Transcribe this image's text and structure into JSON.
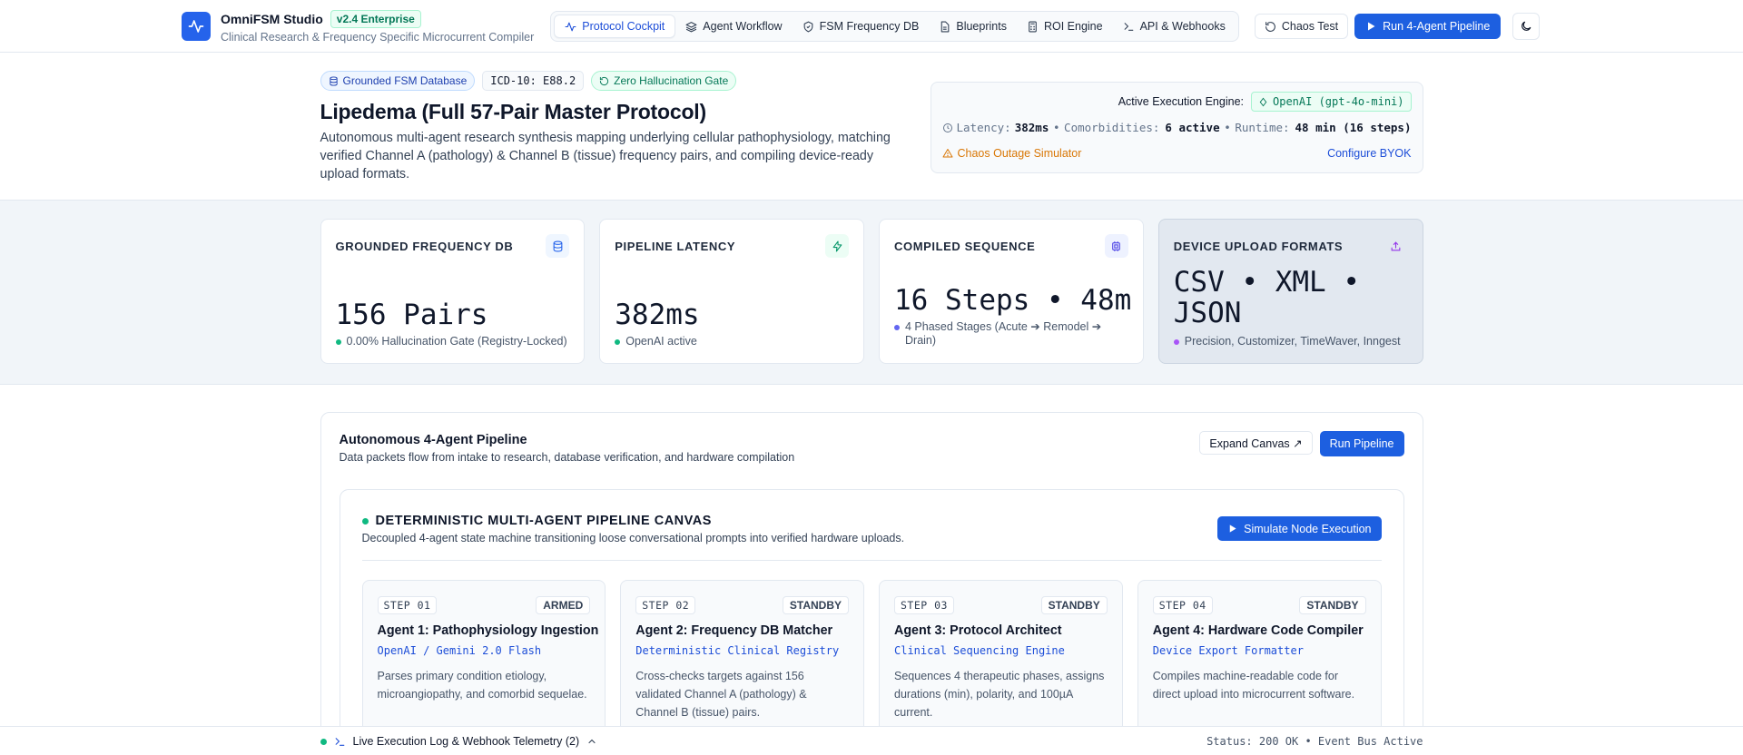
{
  "header": {
    "brand_name": "OmniFSM Studio",
    "brand_version": "v2.4 Enterprise",
    "brand_subtitle": "Clinical Research & Frequency Specific Microcurrent Compiler",
    "nav": [
      {
        "label": "Protocol Cockpit",
        "icon": "activity-icon",
        "active": true
      },
      {
        "label": "Agent Workflow",
        "icon": "layers-icon",
        "active": false
      },
      {
        "label": "FSM Frequency DB",
        "icon": "shield-icon",
        "active": false
      },
      {
        "label": "Blueprints",
        "icon": "file-icon",
        "active": false
      },
      {
        "label": "ROI Engine",
        "icon": "calculator-icon",
        "active": false
      },
      {
        "label": "API & Webhooks",
        "icon": "terminal-icon",
        "active": false
      }
    ],
    "chaos_test_label": "Chaos Test",
    "run_pipeline_label": "Run 4-Agent Pipeline",
    "theme_toggle_icon": "moon-icon"
  },
  "hero": {
    "tags": {
      "database": "Grounded FSM Database",
      "icd": "ICD-10: E88.2",
      "gate": "Zero Hallucination Gate"
    },
    "title": "Lipedema (Full 57-Pair Master Protocol)",
    "description": "Autonomous multi-agent research synthesis mapping underlying cellular pathophysiology, matching verified Channel A (pathology) & Channel B (tissue) frequency pairs, and compiling device-ready upload formats."
  },
  "engine": {
    "label": "Active Execution Engine:",
    "engine_name": "OpenAI (gpt-4o-mini)",
    "latency_label": "Latency:",
    "latency_value": "382ms",
    "comorbidities_label": "Comorbidities:",
    "comorbidities_value": "6 active",
    "runtime_label": "Runtime:",
    "runtime_value": "48 min (16 steps)",
    "separator": "•",
    "chaos_label": "Chaos Outage Simulator",
    "byok_label": "Configure BYOK"
  },
  "stats": [
    {
      "title": "GROUNDED FREQUENCY DB",
      "value": "156 Pairs",
      "foot": "0.00% Hallucination Gate (Registry-Locked)",
      "icon": "database-icon",
      "color": "#2563eb",
      "icon_bg": "#eff6ff",
      "dot": "#10b981"
    },
    {
      "title": "PIPELINE LATENCY",
      "value": "382ms",
      "foot": "OpenAI active",
      "icon": "zap-icon",
      "color": "#059669",
      "icon_bg": "#ecfdf5",
      "dot": "#10b981"
    },
    {
      "title": "COMPILED SEQUENCE",
      "value": "16 Steps • 48m",
      "foot": "4 Phased Stages (Acute ➔ Remodel ➔ Drain)",
      "icon": "cpu-icon",
      "color": "#4f46e5",
      "icon_bg": "#eef2ff",
      "dot": "#6366f1"
    },
    {
      "title": "DEVICE UPLOAD FORMATS",
      "value": "CSV • XML • JSON",
      "foot": "Precision, Customizer, TimeWaver, Inngest",
      "icon": "upload-icon",
      "color": "#9333ea",
      "icon_bg": "transparent",
      "dot": "#a855f7"
    }
  ],
  "pipeline": {
    "title": "Autonomous 4-Agent Pipeline",
    "subtitle": "Data packets flow from intake to research, database verification, and hardware compilation",
    "expand_label": "Expand Canvas ↗",
    "run_label": "Run Pipeline",
    "canvas_title": "DETERMINISTIC MULTI-AGENT PIPELINE CANVAS",
    "canvas_subtitle": "Decoupled 4-agent state machine transitioning loose conversational prompts into verified hardware uploads.",
    "simulate_label": "Simulate Node Execution",
    "agents": [
      {
        "step": "STEP 01",
        "status": "ARMED",
        "name": "Agent 1: Pathophysiology Ingestion",
        "model": "OpenAI / Gemini 2.0 Flash",
        "desc": "Parses primary condition etiology, microangiopathy, and comorbid sequelae."
      },
      {
        "step": "STEP 02",
        "status": "STANDBY",
        "name": "Agent 2: Frequency DB Matcher",
        "model": "Deterministic Clinical Registry",
        "desc": "Cross-checks targets against 156 validated Channel A (pathology) & Channel B (tissue) pairs."
      },
      {
        "step": "STEP 03",
        "status": "STANDBY",
        "name": "Agent 3: Protocol Architect",
        "model": "Clinical Sequencing Engine",
        "desc": "Sequences 4 therapeutic phases, assigns durations (min), polarity, and 100µA current."
      },
      {
        "step": "STEP 04",
        "status": "STANDBY",
        "name": "Agent 4: Hardware Code Compiler",
        "model": "Device Export Formatter",
        "desc": "Compiles machine-readable code for direct upload into microcurrent software."
      }
    ]
  },
  "log": {
    "label": "Live Execution Log & Webhook Telemetry (2)",
    "status": "Status: 200 OK • Event Bus Active"
  },
  "colors": {
    "accent": "#1d5fe0",
    "success": "#10b981",
    "warning": "#d97706"
  }
}
